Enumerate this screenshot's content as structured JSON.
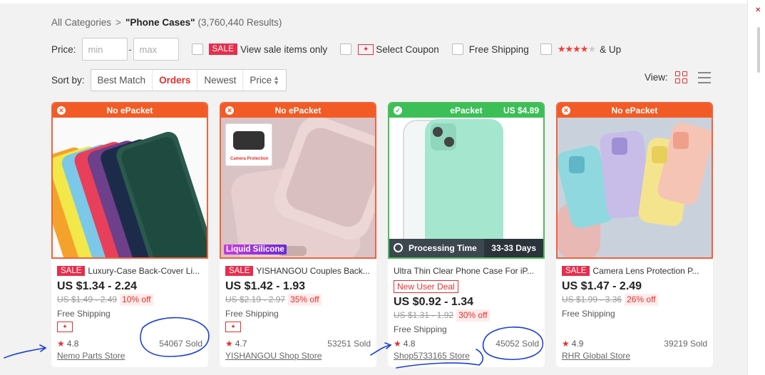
{
  "breadcrumb": {
    "root": "All Categories",
    "sep": ">",
    "query": "\"Phone Cases\"",
    "count": "(3,760,440 Results)"
  },
  "filters": {
    "price_label": "Price:",
    "min_placeholder": "min",
    "max_placeholder": "max",
    "dash": "-",
    "sale_badge": "SALE",
    "sale_label": "View sale items only",
    "coupon_label": "Select Coupon",
    "shipping_label": "Free Shipping",
    "stars": "★★★★",
    "star_dim": "★",
    "stars_label": "& Up"
  },
  "sort": {
    "label": "Sort by:",
    "options": [
      "Best Match",
      "Orders",
      "Newest",
      "Price"
    ],
    "active": "Orders"
  },
  "view": {
    "label": "View:"
  },
  "products": [
    {
      "band": "No ePacket",
      "band_price": "",
      "sale": "SALE",
      "title": "Luxury-Case Back-Cover Li...",
      "price": "US $1.34 - 2.24",
      "old_price": "US $1.49 - 2.49",
      "discount": "10% off",
      "shipping": "Free Shipping",
      "rating": "4.8",
      "sold": "54067 Sold",
      "store": "Nemo Parts Store"
    },
    {
      "band": "No ePacket",
      "band_price": "",
      "sale": "SALE",
      "title": "YISHANGOU Couples Back...",
      "price": "US $1.42 - 1.93",
      "old_price": "US $2.19 - 2.97",
      "discount": "35% off",
      "shipping": "Free Shipping",
      "rating": "4.7",
      "sold": "53251 Sold",
      "store": "YISHANGOU Shop Store",
      "overlay": "Liquid Silicone",
      "camera_label": "Camera Protection"
    },
    {
      "band": "ePacket",
      "band_price": "US $4.89",
      "title": "Ultra Thin Clear Phone Case For iP...",
      "new_deal": "New User Deal",
      "price": "US $0.92 - 1.34",
      "old_price": "US $1.31 - 1.92",
      "discount": "30% off",
      "shipping": "Free Shipping",
      "rating": "4.8",
      "sold": "45052 Sold",
      "store": "Shop5733165 Store",
      "processing_label": "Processing Time",
      "processing_days": "33-33 Days"
    },
    {
      "band": "No ePacket",
      "band_price": "",
      "sale": "SALE",
      "title": "Camera Lens Protection P...",
      "price": "US $1.47 - 2.49",
      "old_price": "US $1.99 - 3.36",
      "discount": "26% off",
      "shipping": "Free Shipping",
      "rating": "4.9",
      "sold": "39219 Sold",
      "store": "RHR Global Store"
    }
  ],
  "colors": {
    "accent": "#e62e2e",
    "band_orange": "#f25b25",
    "band_green": "#3cbf57",
    "annotation": "#1a3fd6"
  }
}
